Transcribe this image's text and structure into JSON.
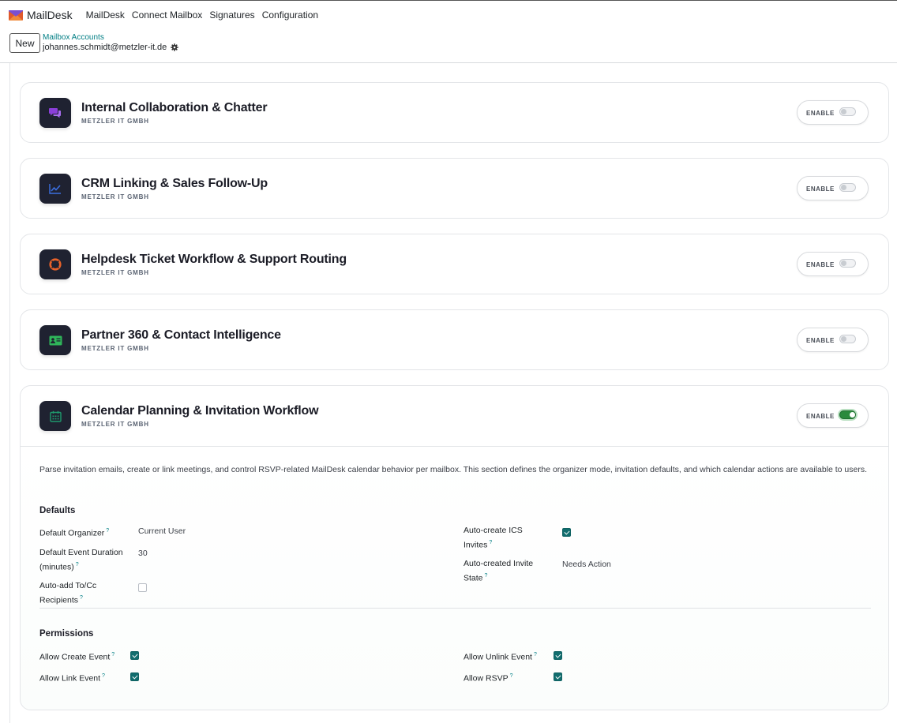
{
  "app": {
    "brand": "MailDesk",
    "menu": [
      "MailDesk",
      "Connect Mailbox",
      "Signatures",
      "Configuration"
    ]
  },
  "control_panel": {
    "new_label": "New",
    "breadcrumb": "Mailbox Accounts",
    "record": "johannes.schmidt@metzler-it.de"
  },
  "modules": [
    {
      "title": "Internal Collaboration & Chatter",
      "company": "METZLER IT GMBH",
      "enable_label": "ENABLE",
      "enabled": false,
      "icon": "chat-bubbles-icon",
      "icon_color": "#8b3fd9"
    },
    {
      "title": "CRM Linking & Sales Follow-Up",
      "company": "METZLER IT GMBH",
      "enable_label": "ENABLE",
      "enabled": false,
      "icon": "trend-chart-icon",
      "icon_color": "#3b6fe0"
    },
    {
      "title": "Helpdesk Ticket Workflow & Support Routing",
      "company": "METZLER IT GMBH",
      "enable_label": "ENABLE",
      "enabled": false,
      "icon": "lifebuoy-icon",
      "icon_color": "#e8622a"
    },
    {
      "title": "Partner 360 & Contact Intelligence",
      "company": "METZLER IT GMBH",
      "enable_label": "ENABLE",
      "enabled": false,
      "icon": "id-card-icon",
      "icon_color": "#2fb65a"
    },
    {
      "title": "Calendar Planning & Invitation Workflow",
      "company": "METZLER IT GMBH",
      "enable_label": "ENABLE",
      "enabled": true,
      "icon": "calendar-icon",
      "icon_color": "#1f9a6d"
    }
  ],
  "calendar": {
    "description": "Parse invitation emails, create or link meetings, and control RSVP-related MailDesk calendar behavior per mailbox. This section defines the organizer mode, invitation defaults, and which calendar actions are available to users.",
    "defaults_title": "Defaults",
    "default_organizer_label": "Default Organizer",
    "default_organizer_value": "Current User",
    "duration_label_1": "Default Event Duration",
    "duration_label_2": "(minutes)",
    "duration_value": "30",
    "auto_add_label_1": "Auto-add To/Cc",
    "auto_add_label_2": "Recipients",
    "auto_add_checked": false,
    "auto_ics_label_1": "Auto-create ICS",
    "auto_ics_label_2": "Invites",
    "auto_ics_checked": true,
    "invite_state_label_1": "Auto-created Invite",
    "invite_state_label_2": "State",
    "invite_state_value": "Needs Action",
    "permissions_title": "Permissions",
    "allow_create_label": "Allow Create Event",
    "allow_create_checked": true,
    "allow_link_label": "Allow Link Event",
    "allow_link_checked": true,
    "allow_unlink_label": "Allow Unlink Event",
    "allow_unlink_checked": true,
    "allow_rsvp_label": "Allow RSVP",
    "allow_rsvp_checked": true,
    "help_mark": "?"
  },
  "colors": {
    "accent": "#017e84",
    "checkbox": "#116d6e",
    "toggle_on": "#2a8a3d",
    "icon_bg": "#1f2231"
  }
}
